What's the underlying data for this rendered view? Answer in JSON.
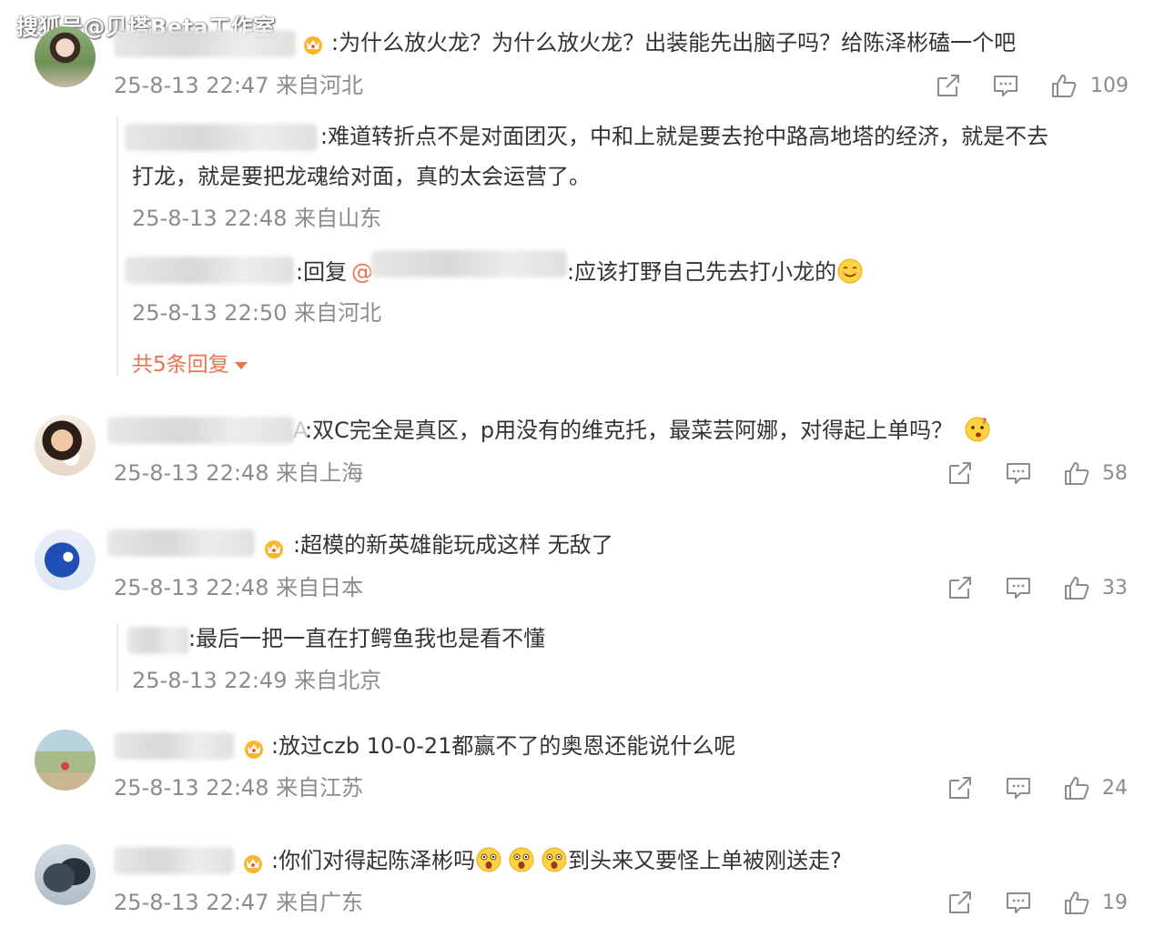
{
  "watermark": "搜狐号@贝塔Beta工作室",
  "comments": [
    {
      "text": ":为什么放火龙？为什么放火龙？出装能先出脑子吗？给陈泽彬磕一个吧",
      "meta": "25-8-13 22:47 来自河北",
      "likes": "109",
      "replies": [
        {
          "text": ":难道转折点不是对面团灭，中和上就是要去抢中路高地塔的经济，就是不去",
          "text2": "打龙，就是要把龙魂给对面，真的太会运营了。",
          "meta": "25-8-13 22:48 来自山东"
        },
        {
          "text": ":回复",
          "mention": "@",
          "text2": ":应该打野自己先去打小龙的",
          "meta": "25-8-13 22:50 来自河北"
        }
      ],
      "more": "共5条回复"
    },
    {
      "text": ":双C完全是真区，p用没有的维克托，最菜芸阿娜，对得起上单吗？",
      "name_tail": "A",
      "meta": "25-8-13 22:48 来自上海",
      "likes": "58"
    },
    {
      "text": ":超模的新英雄能玩成这样 无敌了",
      "meta": "25-8-13 22:48 来自日本",
      "likes": "33",
      "replies": [
        {
          "text": ":最后一把一直在打鳄鱼我也是看不懂",
          "meta": "25-8-13 22:49 来自北京"
        }
      ]
    },
    {
      "text": ":放过czb 10-0-21都赢不了的奥恩还能说什么呢",
      "meta": "25-8-13 22:48 来自江苏",
      "likes": "24"
    },
    {
      "text": ":你们对得起陈泽彬吗",
      "text2": "到头来又要怪上单被刚送走?",
      "meta": "25-8-13 22:47 来自广东",
      "likes": "19"
    }
  ],
  "icons": [
    "share-icon",
    "comment-icon",
    "like-icon",
    "crown-badge-icon",
    "smile-emoji",
    "shocked-emoji"
  ],
  "colors": {
    "text": "#333333",
    "meta": "#8c8c8c",
    "more": "#eb7350",
    "icon": "#8c8c8c"
  }
}
